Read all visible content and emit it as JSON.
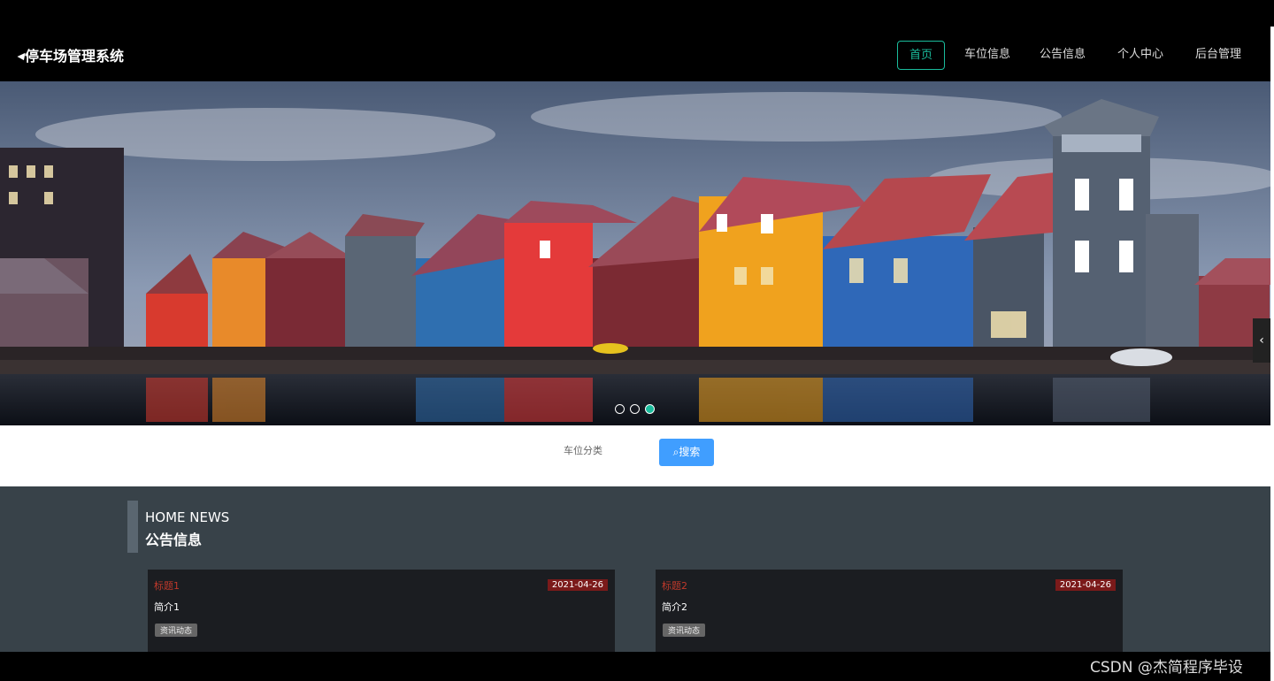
{
  "app": {
    "title": "停车场管理系统"
  },
  "nav": {
    "items": [
      {
        "label": "首页",
        "active": true
      },
      {
        "label": "车位信息",
        "active": false
      },
      {
        "label": "公告信息",
        "active": false
      },
      {
        "label": "个人中心",
        "active": false
      },
      {
        "label": "后台管理",
        "active": false
      }
    ]
  },
  "carousel": {
    "slide_count": 3,
    "active_index": 2,
    "arrow_icon": "chevron-left-icon"
  },
  "search": {
    "label": "车位分类",
    "button_label": "搜索",
    "button_icon": "search-icon"
  },
  "news": {
    "heading_en": "HOME NEWS",
    "heading_cn": "公告信息",
    "items": [
      {
        "title": "标题1",
        "date": "2021-04-26",
        "summary": "简介1",
        "tag": "资讯动态"
      },
      {
        "title": "标题2",
        "date": "2021-04-26",
        "summary": "简介2",
        "tag": "资讯动态"
      }
    ]
  },
  "watermark": "CSDN @杰简程序毕设",
  "colors": {
    "accent": "#1abc9c",
    "button": "#409eff",
    "news_bg": "#384249",
    "card_title": "#c0392b"
  }
}
